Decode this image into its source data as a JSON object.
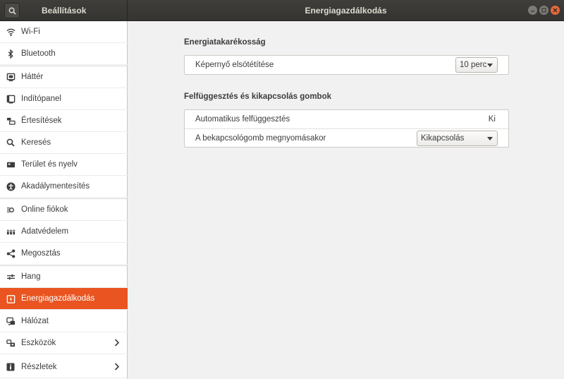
{
  "header": {
    "app_title": "Beállítások",
    "panel_title": "Energiagazdálkodás"
  },
  "sidebar": {
    "items": [
      {
        "label": "Wi-Fi",
        "icon": "wifi-icon"
      },
      {
        "label": "Bluetooth",
        "icon": "bluetooth-icon"
      },
      {
        "label": "Háttér",
        "icon": "background-icon"
      },
      {
        "label": "Indítópanel",
        "icon": "dock-icon"
      },
      {
        "label": "Értesítések",
        "icon": "notifications-icon"
      },
      {
        "label": "Keresés",
        "icon": "search-icon"
      },
      {
        "label": "Terület és nyelv",
        "icon": "region-icon"
      },
      {
        "label": "Akadálymentesítés",
        "icon": "accessibility-icon"
      },
      {
        "label": "Online fiókok",
        "icon": "online-accounts-icon"
      },
      {
        "label": "Adatvédelem",
        "icon": "privacy-icon"
      },
      {
        "label": "Megosztás",
        "icon": "share-icon"
      },
      {
        "label": "Hang",
        "icon": "sound-icon"
      },
      {
        "label": "Energiagazdálkodás",
        "icon": "power-icon",
        "active": true
      },
      {
        "label": "Hálózat",
        "icon": "network-icon"
      },
      {
        "label": "Eszközök",
        "icon": "devices-icon",
        "has_submenu": true
      },
      {
        "label": "Részletek",
        "icon": "details-icon",
        "has_submenu": true
      }
    ]
  },
  "power_saving": {
    "title": "Energiatakarékosság",
    "blank_screen_label": "Képernyő elsötétítése",
    "blank_screen_value": "10 perc"
  },
  "suspend": {
    "title": "Felfüggesztés és kikapcsolás gombok",
    "auto_suspend_label": "Automatikus felfüggesztés",
    "auto_suspend_value": "Ki",
    "power_button_label": "A bekapcsológomb megnyomásakor",
    "power_button_value": "Kikapcsolás"
  },
  "colors": {
    "accent": "#e95420",
    "headerbar": "#3a3936"
  }
}
